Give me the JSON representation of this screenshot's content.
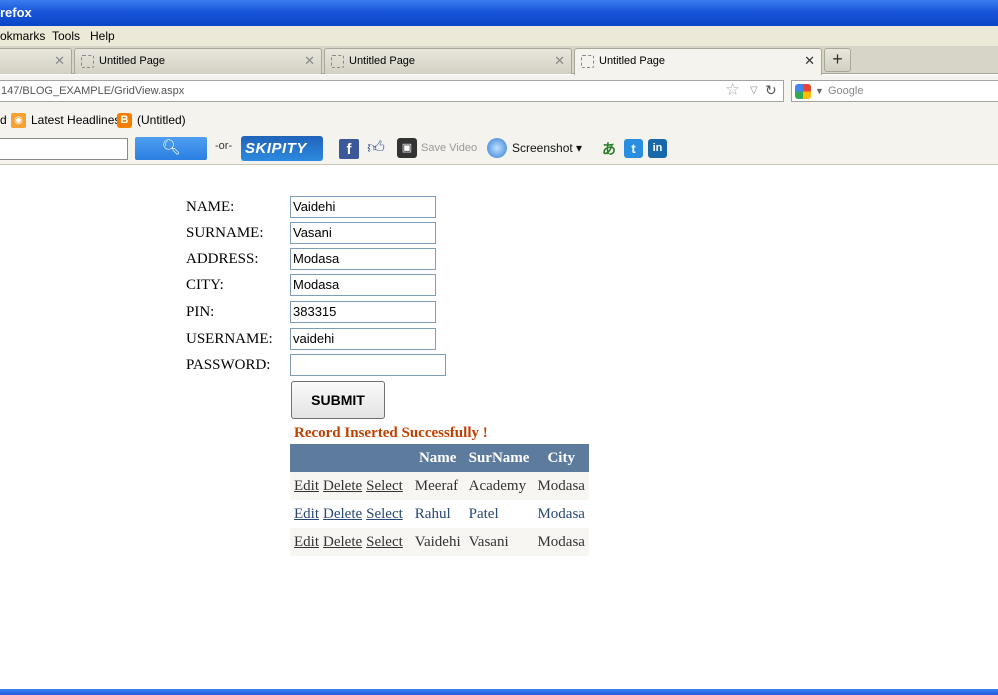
{
  "window": {
    "title": "refox"
  },
  "menu": {
    "items": [
      "okmarks",
      "Tools",
      "Help"
    ]
  },
  "tabs": [
    {
      "label": "Untitled Page"
    },
    {
      "label": "Untitled Page"
    },
    {
      "label": "Untitled Page"
    }
  ],
  "address": {
    "url": "147/BLOG_EXAMPLE/GridView.aspx"
  },
  "search": {
    "placeholder": "Google"
  },
  "bookmarks": {
    "items": [
      "d",
      "Latest Headlines",
      "(Untitled)"
    ]
  },
  "addon_toolbar": {
    "or_label": "-or-",
    "skipity_label": "SKIPITY",
    "save_video_label": "Save Video",
    "screenshot_label": "Screenshot"
  },
  "form": {
    "fields": [
      {
        "label": "NAME:",
        "value": "Vaidehi"
      },
      {
        "label": "SURNAME:",
        "value": "Vasani"
      },
      {
        "label": "ADDRESS:",
        "value": "Modasa"
      },
      {
        "label": "CITY:",
        "value": "Modasa"
      },
      {
        "label": "PIN:",
        "value": "383315"
      },
      {
        "label": "USERNAME:",
        "value": "vaidehi"
      },
      {
        "label": "PASSWORD:",
        "value": ""
      }
    ],
    "submit_label": "SUBMIT",
    "message": "Record Inserted Successfully !"
  },
  "grid": {
    "columns": [
      "",
      "Name",
      "SurName",
      "City"
    ],
    "actions": [
      "Edit",
      "Delete",
      "Select"
    ],
    "rows": [
      {
        "name": "Meeraf",
        "surname": "Academy",
        "city": "Modasa"
      },
      {
        "name": "Rahul",
        "surname": "Patel",
        "city": "Modasa"
      },
      {
        "name": "Vaidehi",
        "surname": "Vasani",
        "city": "Modasa"
      }
    ]
  }
}
